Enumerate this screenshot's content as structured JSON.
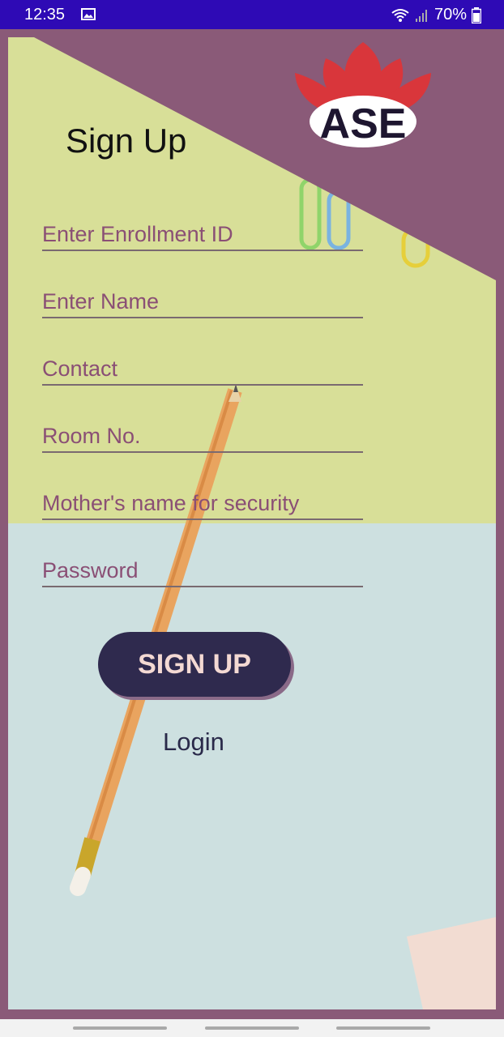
{
  "status_bar": {
    "time": "12:35",
    "battery": "70%"
  },
  "logo": {
    "text": "ASE"
  },
  "form": {
    "title": "Sign Up",
    "fields": [
      {
        "placeholder": "Enter Enrollment ID"
      },
      {
        "placeholder": "Enter Name"
      },
      {
        "placeholder": "Contact"
      },
      {
        "placeholder": "Room No."
      },
      {
        "placeholder": "Mother's name for security"
      },
      {
        "placeholder": "Password"
      }
    ],
    "signup_label": "SIGN UP",
    "login_label": "Login"
  },
  "colors": {
    "status_bar": "#2e0ab5",
    "frame": "#8a5a78",
    "button": "#2f2a4e",
    "placeholder": "#8a4f75"
  }
}
